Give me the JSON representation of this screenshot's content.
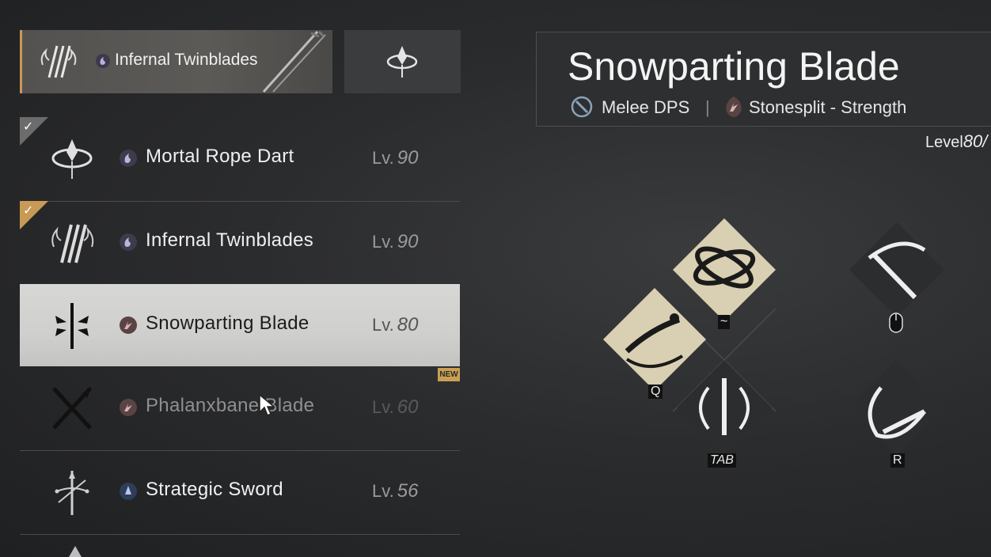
{
  "equipped": {
    "primary": {
      "name": "Infernal Twinblades",
      "icon": "twinblades-icon"
    },
    "secondary": {
      "icon": "rope-dart-icon"
    }
  },
  "weapons": [
    {
      "name": "Mortal Rope Dart",
      "lv_label": "Lv.",
      "level": "90",
      "checked": "grey"
    },
    {
      "name": "Infernal Twinblades",
      "lv_label": "Lv.",
      "level": "90",
      "checked": "gold"
    },
    {
      "name": "Snowparting Blade",
      "lv_label": "Lv.",
      "level": "80",
      "selected": true,
      "new_tag": "NEW"
    },
    {
      "name": "Phalanxbane Blade",
      "lv_label": "Lv.",
      "level": "60"
    },
    {
      "name": "Strategic Sword",
      "lv_label": "Lv.",
      "level": "56"
    }
  ],
  "detail": {
    "title": "Snowparting Blade",
    "role": "Melee DPS",
    "separator": "|",
    "path": "Stonesplit - Strength",
    "level_label": "Level",
    "level_value": "80/"
  },
  "skills": {
    "tilde_key": "~",
    "mouse_key_icon": "mouse-icon",
    "q_key": "Q",
    "tab_key": "TAB",
    "r_key": "R"
  },
  "colors": {
    "accent_gold": "#c99a55",
    "selected_row": "#d3d3d1",
    "skill_active": "#d9cfb2"
  }
}
